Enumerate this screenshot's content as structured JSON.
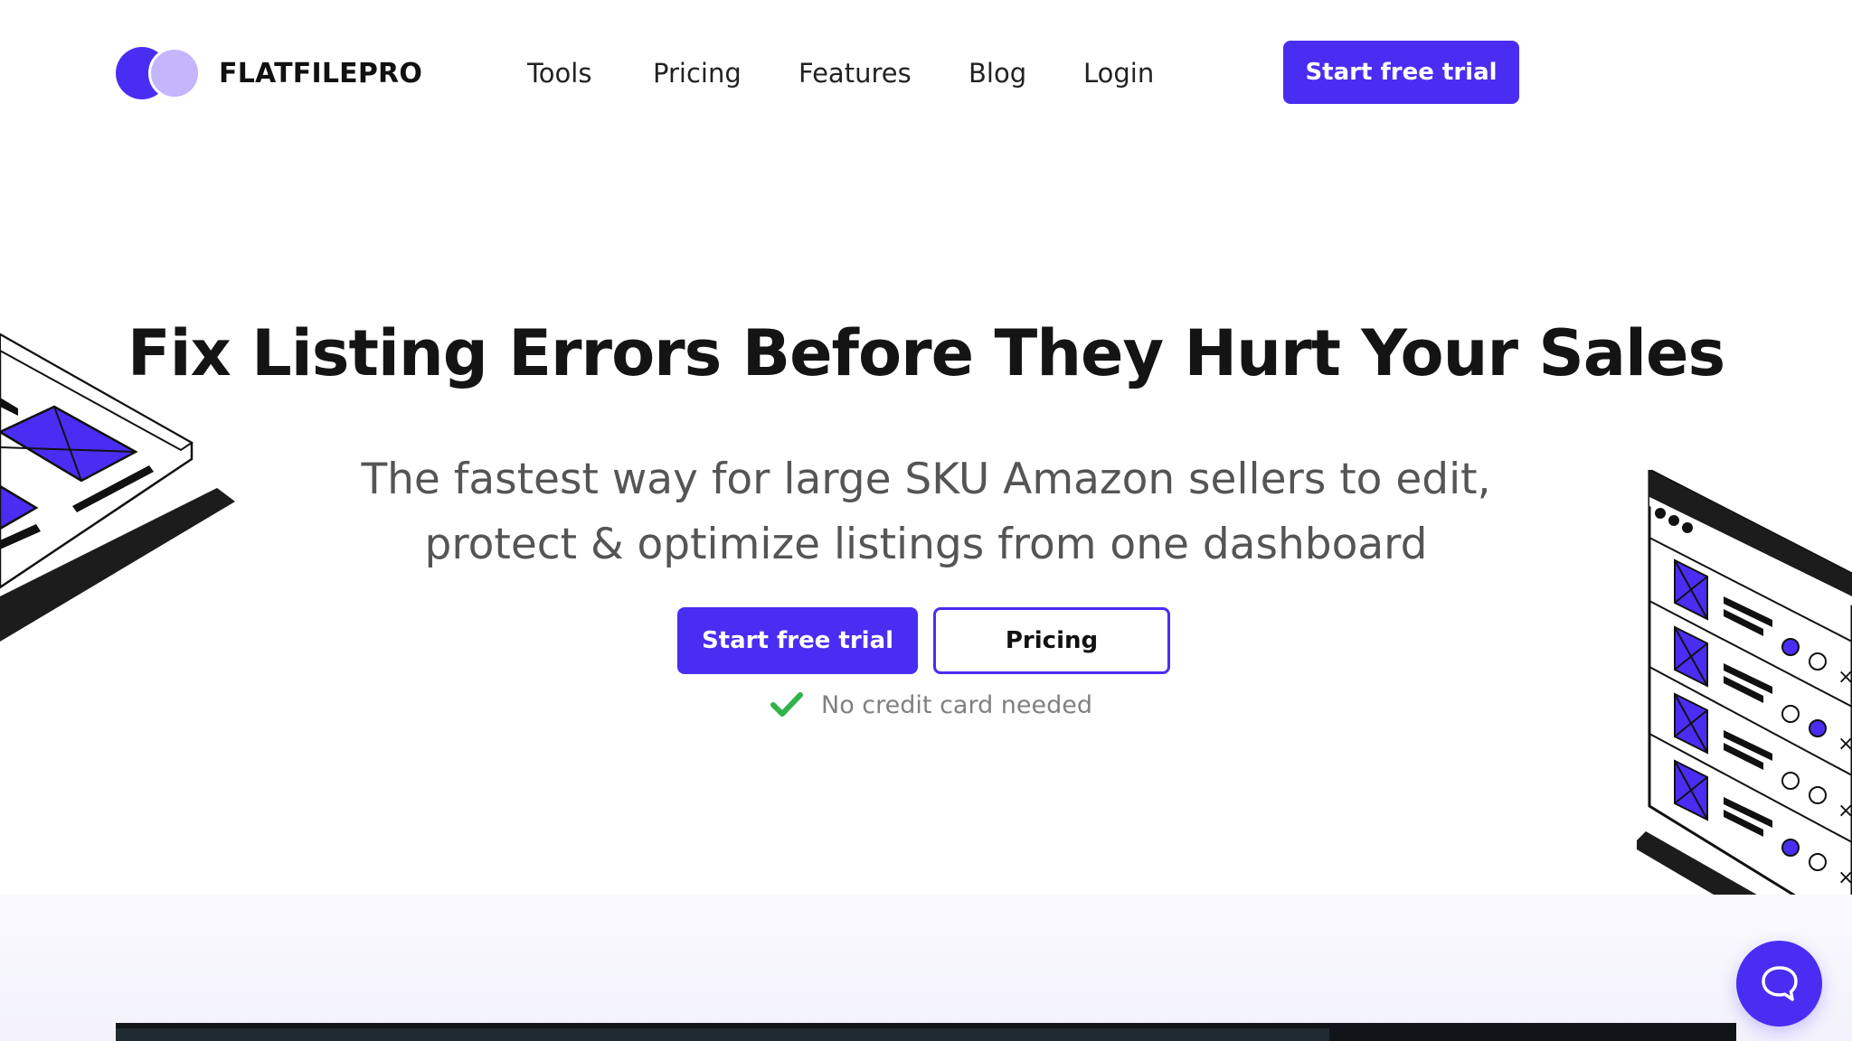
{
  "brand": {
    "name": "FLATFILEPRO",
    "colors": {
      "primary": "#4a2df2",
      "primary_light": "#c4b5fd",
      "text": "#151515",
      "success": "#2fb34a"
    }
  },
  "header": {
    "nav": [
      {
        "label": "Tools"
      },
      {
        "label": "Pricing"
      },
      {
        "label": "Features"
      },
      {
        "label": "Blog"
      },
      {
        "label": "Login"
      }
    ],
    "cta_label": "Start free trial"
  },
  "hero": {
    "title": "Fix Listing Errors Before They Hurt Your Sales",
    "subtitle_line1": "The fastest way for large SKU Amazon sellers to edit,",
    "subtitle_line2": "protect & optimize listings from one dashboard",
    "primary_cta": "Start free trial",
    "secondary_cta": "Pricing",
    "note": "No credit card needed",
    "note_icon": "checkmark-icon"
  },
  "chat_widget": {
    "icon": "chat-bubble-icon"
  }
}
